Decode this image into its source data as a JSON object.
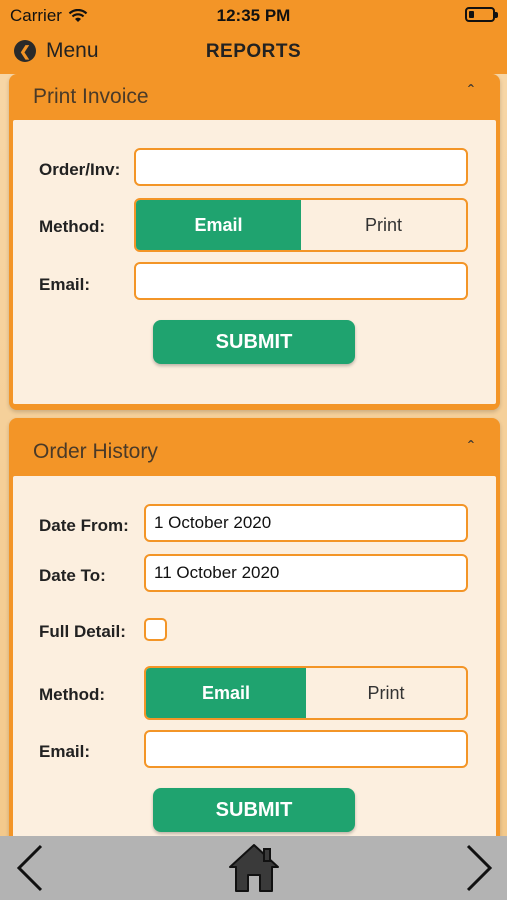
{
  "status": {
    "carrier": "Carrier",
    "time": "12:35 PM"
  },
  "nav": {
    "back_label": "Menu",
    "title": "REPORTS"
  },
  "print_invoice": {
    "title": "Print Invoice",
    "order_label": "Order/Inv:",
    "order_value": "",
    "method_label": "Method:",
    "method_options": [
      "Email",
      "Print"
    ],
    "method_selected": "Email",
    "email_label": "Email:",
    "email_value": "",
    "submit_label": "SUBMIT"
  },
  "order_history": {
    "title": "Order History",
    "date_from_label": "Date From:",
    "date_from_value": "1 October 2020",
    "date_to_label": "Date To:",
    "date_to_value": "11 October 2020",
    "full_detail_label": "Full Detail:",
    "full_detail_checked": false,
    "method_label": "Method:",
    "method_options": [
      "Email",
      "Print"
    ],
    "method_selected": "Email",
    "email_label": "Email:",
    "email_value": "",
    "submit_label": "SUBMIT"
  },
  "bottom_bar": {
    "icons": [
      "chevron-left-icon",
      "home-icon",
      "chevron-right-icon"
    ]
  },
  "colors": {
    "accent": "#f39527",
    "green": "#1fa36f",
    "panel_bg": "#fcefdf",
    "bottom_bar": "#b3b3b3"
  }
}
